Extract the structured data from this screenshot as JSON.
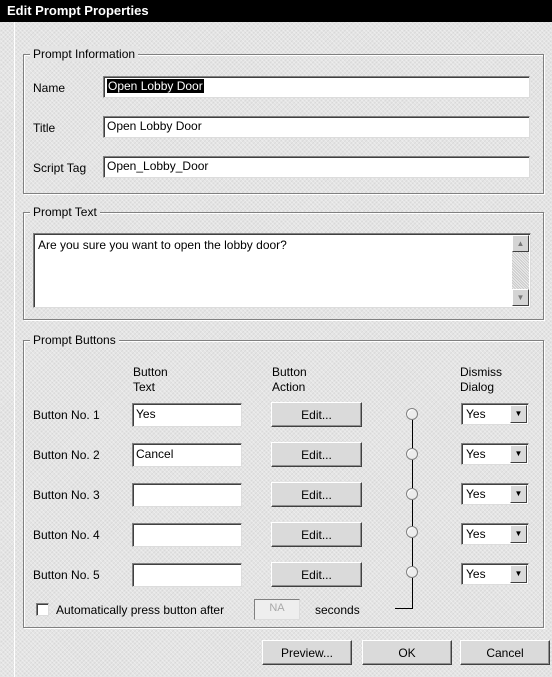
{
  "window": {
    "title": "Edit Prompt Properties"
  },
  "prompt_information": {
    "legend": "Prompt Information",
    "name_label": "Name",
    "name_value": "Open Lobby Door",
    "title_label": "Title",
    "title_value": "Open Lobby Door",
    "script_tag_label": "Script Tag",
    "script_tag_value": "Open_Lobby_Door"
  },
  "prompt_text": {
    "legend": "Prompt Text",
    "value": "Are you sure you want to open the lobby door?"
  },
  "prompt_buttons": {
    "legend": "Prompt Buttons",
    "header_button_text_1": "Button",
    "header_button_text_2": "Text",
    "header_button_action_1": "Button",
    "header_button_action_2": "Action",
    "header_dismiss_1": "Dismiss",
    "header_dismiss_2": "Dialog",
    "rows": [
      {
        "label": "Button No. 1",
        "text": "Yes",
        "action_label": "Edit...",
        "dismiss": "Yes"
      },
      {
        "label": "Button No. 2",
        "text": "Cancel",
        "action_label": "Edit...",
        "dismiss": "Yes"
      },
      {
        "label": "Button No. 3",
        "text": "",
        "action_label": "Edit...",
        "dismiss": "Yes"
      },
      {
        "label": "Button No. 4",
        "text": "",
        "action_label": "Edit...",
        "dismiss": "Yes"
      },
      {
        "label": "Button No. 5",
        "text": "",
        "action_label": "Edit...",
        "dismiss": "Yes"
      }
    ],
    "auto_press": {
      "label": "Automatically press button after",
      "checked": false,
      "seconds_value": "NA",
      "seconds_label": "seconds"
    }
  },
  "footer": {
    "preview_label": "Preview...",
    "ok_label": "OK",
    "cancel_label": "Cancel"
  },
  "icons": {
    "scroll_up": "scroll-up-arrow-icon",
    "scroll_down": "scroll-down-arrow-icon",
    "dropdown": "chevron-down-icon",
    "radio": "radio-button-icon"
  }
}
